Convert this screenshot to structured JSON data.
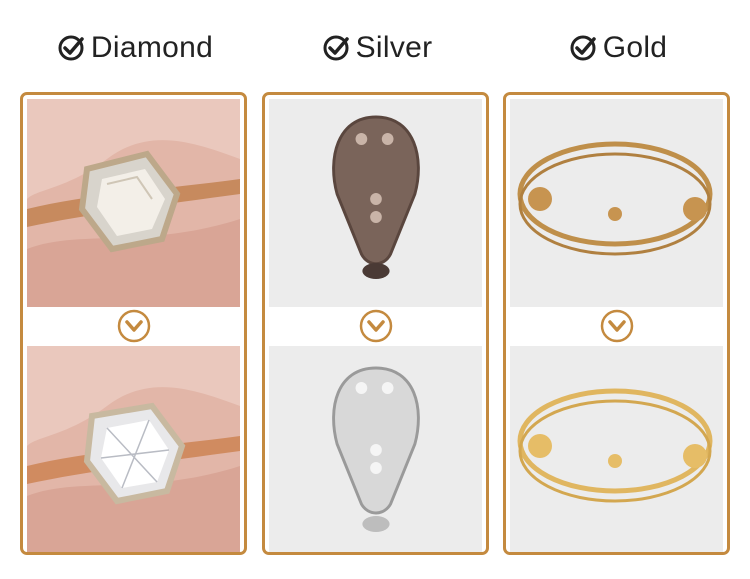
{
  "columns": [
    {
      "label": "Diamond"
    },
    {
      "label": "Silver"
    },
    {
      "label": "Gold"
    }
  ],
  "colors": {
    "accent": "#c48a3f",
    "heading": "#222222",
    "skin": "#e7c3b7",
    "gold": "#d6a85a",
    "silver": "#cfcfcf"
  },
  "icons": {
    "heading": "check-circle-icon",
    "transition": "chevron-down-circle-icon"
  }
}
